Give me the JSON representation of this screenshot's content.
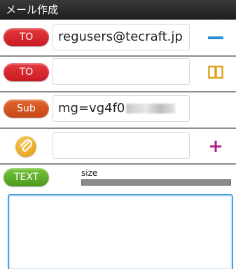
{
  "title": "メール作成",
  "to_rows": [
    {
      "label": "TO",
      "value": "regusers@tecraft.jp"
    },
    {
      "label": "TO",
      "value": ""
    }
  ],
  "subject": {
    "label": "Sub",
    "value_visible": "mg=vg4f0"
  },
  "attachment": {
    "icon": "paperclip-icon",
    "value": ""
  },
  "text": {
    "label": "TEXT",
    "size_label": "size",
    "body": ""
  },
  "icons": {
    "remove_recipient": "minus-icon",
    "address_book": "book-icon",
    "add_attachment": "plus-icon"
  },
  "colors": {
    "titlebar": "#2a2a2a",
    "to_pill": "#d9262d",
    "sub_pill": "#d55622",
    "text_pill": "#5fae2a",
    "attach_icon": "#f0b02a",
    "minus": "#2b8fd6",
    "book": "#e0a21c",
    "plus": "#b01f8a",
    "textarea_border": "#4aa0e0"
  }
}
